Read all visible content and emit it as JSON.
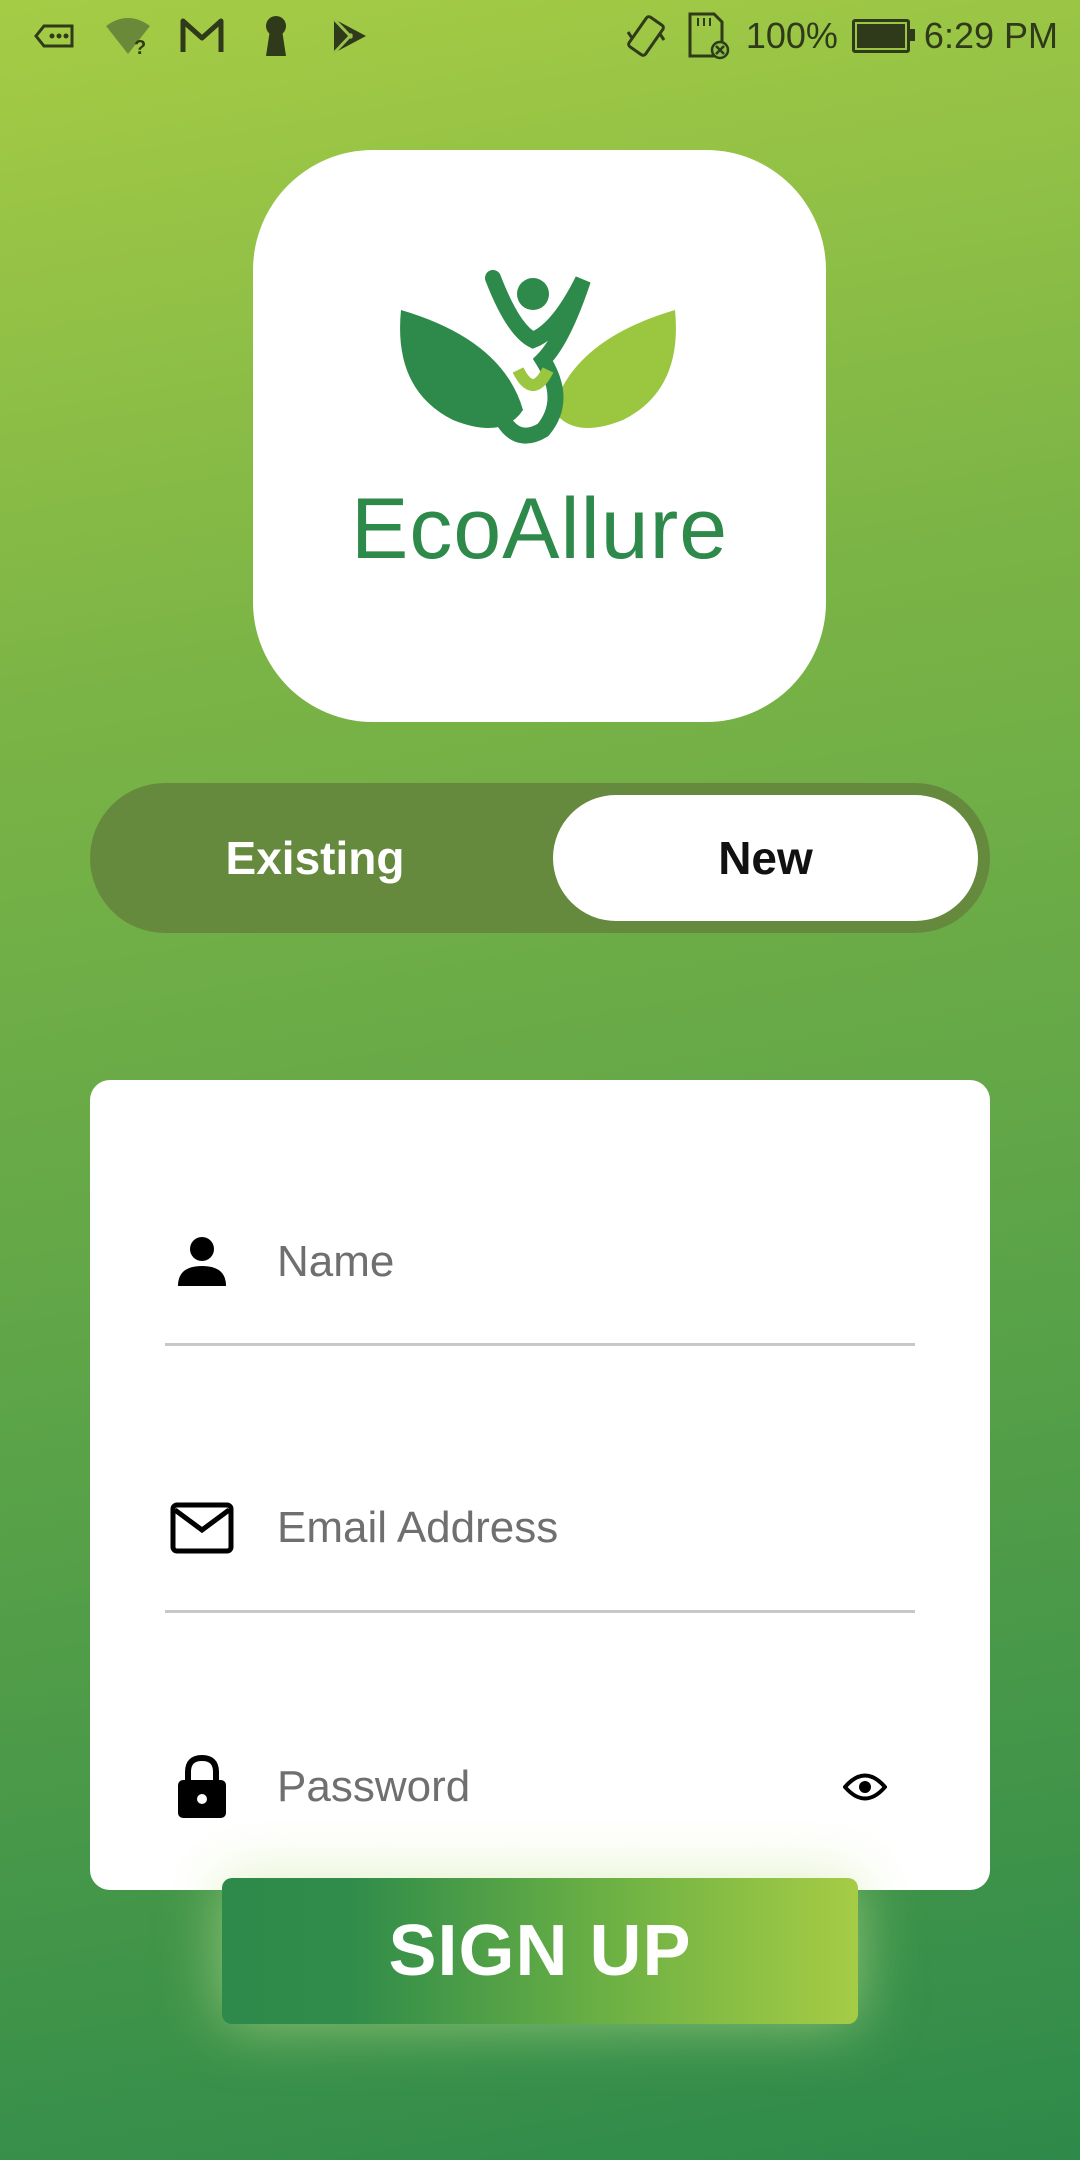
{
  "status_bar": {
    "icons": [
      "ticket-icon",
      "wifi-question-icon",
      "gmail-icon",
      "keyhole-icon",
      "play-store-icon"
    ],
    "right_icons": [
      "vibrate-icon",
      "sdcard-icon",
      "battery-icon"
    ],
    "battery": "100%",
    "battery_level": 1.0,
    "time": "6:29 PM"
  },
  "logo": {
    "text": "EcoAllure"
  },
  "toggle": {
    "existing": "Existing",
    "new": "New",
    "selected": "New"
  },
  "form": {
    "name_placeholder": "Name",
    "email_placeholder": "Email Address",
    "password_placeholder": "Password",
    "name_icon": "person-icon",
    "email_icon": "mail-icon",
    "password_icon": "lock-icon",
    "eye_icon": "eye-icon"
  },
  "signup_button": "SIGN UP",
  "colors": {
    "brand_dark": "#2e8a4a",
    "brand_light": "#a6cc45",
    "toggle_bg": "#658a3e"
  }
}
